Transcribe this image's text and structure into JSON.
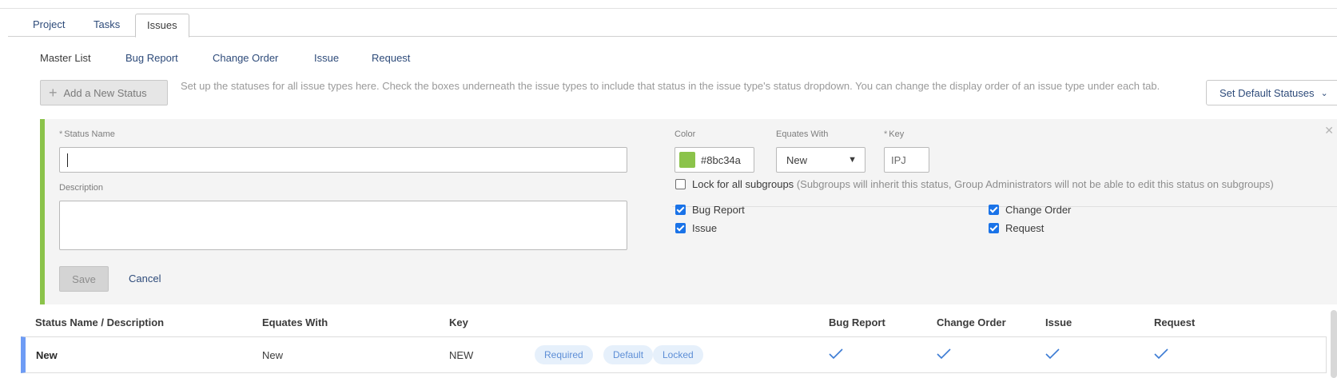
{
  "tabs": [
    {
      "label": "Project"
    },
    {
      "label": "Tasks"
    },
    {
      "label": "Issues",
      "active": true
    }
  ],
  "subtabs": [
    {
      "label": "Master List"
    },
    {
      "label": "Bug Report"
    },
    {
      "label": "Change Order"
    },
    {
      "label": "Issue"
    },
    {
      "label": "Request"
    }
  ],
  "toolbar": {
    "add_label": "Add a New Status",
    "intro": "Set up the statuses for all issue types here. Check the boxes underneath the issue types to include that status in the issue type's status dropdown. You can change the display order of an issue type under each tab.",
    "default_label": "Set Default Statuses"
  },
  "form": {
    "accent_color": "#8bc34a",
    "status_name_label": "Status Name",
    "status_name_value": "",
    "description_label": "Description",
    "color_label": "Color",
    "color_value": "#8bc34a",
    "color_text": "#8bc34a",
    "equates_label": "Equates With",
    "equates_value": "New",
    "key_label": "Key",
    "key_value": "IPJ",
    "lock_label": "Lock for all subgroups",
    "lock_note": "(Subgroups will inherit this status, Group Administrators will not be able to edit this status on subgroups)",
    "lock_checked": false,
    "types": [
      {
        "label": "Bug Report",
        "checked": true
      },
      {
        "label": "Change Order",
        "checked": true
      },
      {
        "label": "Issue",
        "checked": true
      },
      {
        "label": "Request",
        "checked": true
      }
    ],
    "save_label": "Save",
    "cancel_label": "Cancel"
  },
  "table": {
    "headers": {
      "name": "Status Name / Description",
      "equates": "Equates With",
      "key": "Key",
      "bug": "Bug Report",
      "change": "Change Order",
      "issue": "Issue",
      "request": "Request"
    },
    "rows": [
      {
        "name": "New",
        "equates": "New",
        "key": "NEW",
        "row_color": "#6e9cf5",
        "badges": [
          "Required",
          "Default",
          "Locked"
        ],
        "bug": true,
        "change": true,
        "issue": true,
        "request": true
      }
    ]
  }
}
